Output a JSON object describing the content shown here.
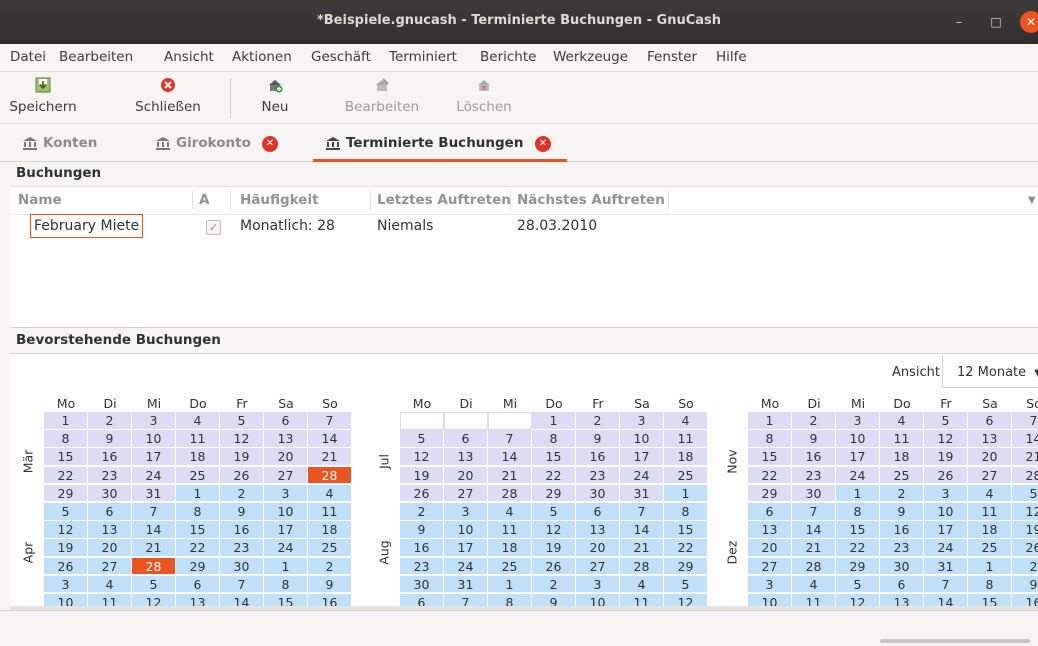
{
  "window": {
    "title": "*Beispiele.gnucash - Terminierte Buchungen - GnuCash"
  },
  "menu": [
    "Datei",
    "Bearbeiten",
    "Ansicht",
    "Aktionen",
    "Geschäft",
    "Terminiert",
    "Berichte",
    "Werkzeuge",
    "Fenster",
    "Hilfe"
  ],
  "toolbar": {
    "save": "Speichern",
    "close": "Schließen",
    "new": "Neu",
    "edit": "Bearbeiten",
    "delete": "Löschen"
  },
  "tabs": [
    "Konten",
    "Girokonto",
    "Terminierte Buchungen"
  ],
  "buchungen": {
    "title": "Buchungen",
    "columns": [
      "Name",
      "A",
      "Häufigkeit",
      "Letztes Auftreten",
      "Nächstes Auftreten"
    ],
    "rows": [
      {
        "name": "February Miete",
        "active": true,
        "frequency": "Monatlich: 28",
        "last": "Niemals",
        "next": "28.03.2010"
      }
    ]
  },
  "calendar": {
    "title": "Bevorstehende Buchungen",
    "view_label": "Ansicht",
    "view_value": "12 Monate",
    "weekdays": [
      "Mo",
      "Di",
      "Mi",
      "Do",
      "Fr",
      "Sa",
      "So"
    ],
    "month_labels": [
      "Mär",
      "Apr",
      "Jul",
      "Aug",
      "Nov",
      "Dez"
    ]
  },
  "colors": {
    "accent": "#e95420",
    "month_a": "#dddcf5",
    "month_b": "#bfe0f8"
  }
}
